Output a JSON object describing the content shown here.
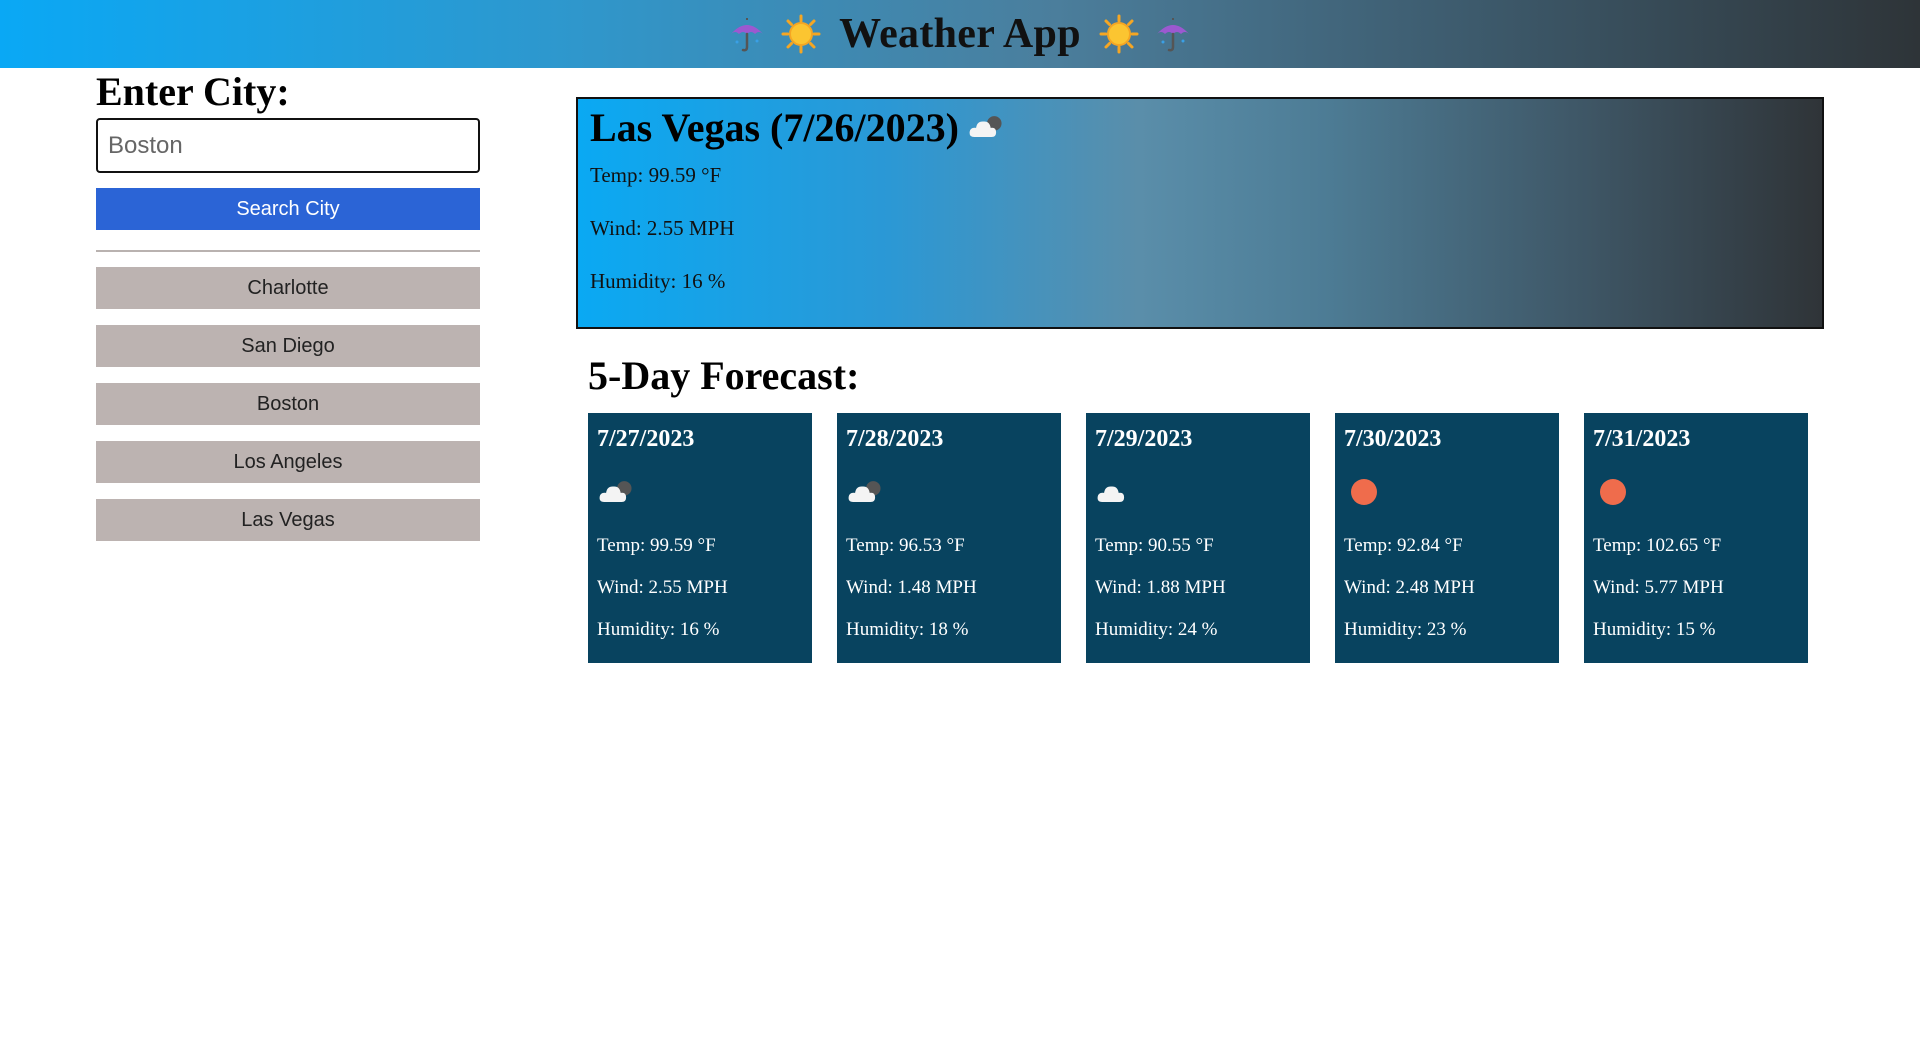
{
  "header": {
    "title": "Weather App",
    "icons": [
      "umbrella-icon",
      "sun-icon",
      "sun-icon",
      "umbrella-icon"
    ]
  },
  "sidebar": {
    "heading": "Enter City:",
    "input_placeholder": "Boston",
    "input_value": "",
    "search_label": "Search City",
    "history": [
      "Charlotte",
      "San Diego",
      "Boston",
      "Los Angeles",
      "Las Vegas"
    ]
  },
  "current": {
    "title": "Las Vegas (7/26/2023)",
    "icon": "cloud-sun-icon",
    "temp": "Temp: 99.59 °F",
    "wind": "Wind: 2.55 MPH",
    "humidity": "Humidity: 16 %"
  },
  "forecast": {
    "title": "5-Day Forecast:",
    "days": [
      {
        "date": "7/27/2023",
        "icon": "cloud-sun-icon",
        "temp": "Temp: 99.59 °F",
        "wind": "Wind: 2.55 MPH",
        "humidity": "Humidity: 16 %"
      },
      {
        "date": "7/28/2023",
        "icon": "cloud-sun-icon",
        "temp": "Temp: 96.53 °F",
        "wind": "Wind: 1.48 MPH",
        "humidity": "Humidity: 18 %"
      },
      {
        "date": "7/29/2023",
        "icon": "cloud-icon",
        "temp": "Temp: 90.55 °F",
        "wind": "Wind: 1.88 MPH",
        "humidity": "Humidity: 24 %"
      },
      {
        "date": "7/30/2023",
        "icon": "sun-icon",
        "temp": "Temp: 92.84 °F",
        "wind": "Wind: 2.48 MPH",
        "humidity": "Humidity: 23 %"
      },
      {
        "date": "7/31/2023",
        "icon": "sun-icon",
        "temp": "Temp: 102.65 °F",
        "wind": "Wind: 5.77 MPH",
        "humidity": "Humidity: 15 %"
      }
    ]
  },
  "colors": {
    "search_button": "#2b64d6",
    "history_button": "#bcb3b1",
    "forecast_card": "#08435f",
    "sun_dot": "#ef6c4c"
  }
}
